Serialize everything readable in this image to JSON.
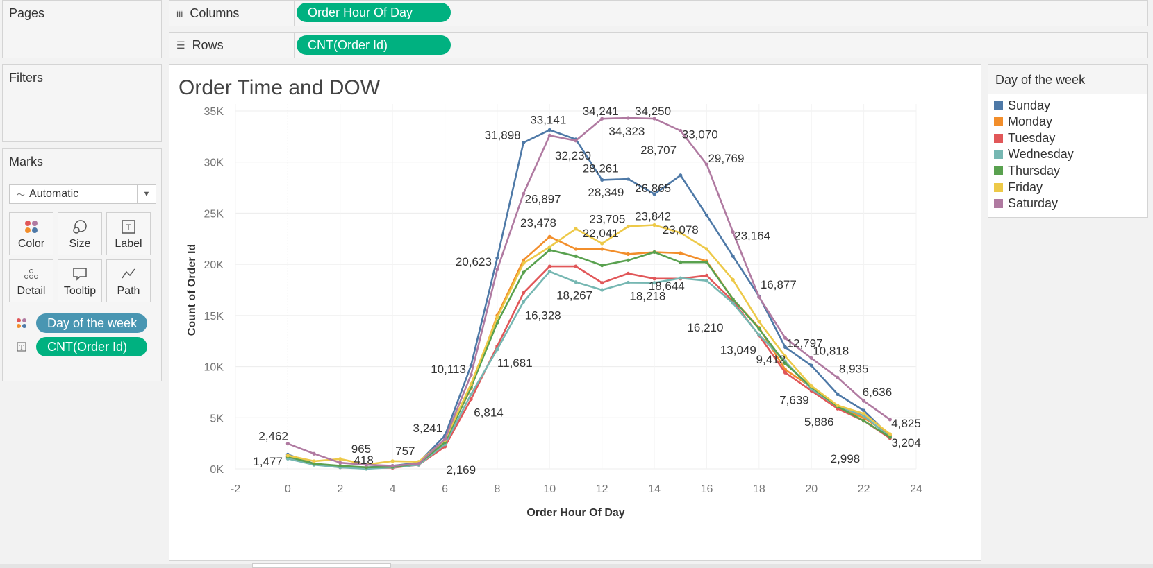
{
  "pages_panel": {
    "title": "Pages"
  },
  "filters_panel": {
    "title": "Filters"
  },
  "columns_shelf": {
    "label": "Columns",
    "pill": "Order Hour Of Day"
  },
  "rows_shelf": {
    "label": "Rows",
    "pill": "CNT(Order Id)"
  },
  "marks_panel": {
    "title": "Marks",
    "mark_type": "Automatic",
    "buttons": [
      {
        "label": "Color"
      },
      {
        "label": "Size"
      },
      {
        "label": "Label"
      },
      {
        "label": "Detail"
      },
      {
        "label": "Tooltip"
      },
      {
        "label": "Path"
      }
    ],
    "fields": [
      {
        "label": "Day of the week",
        "encoding": "color"
      },
      {
        "label": "CNT(Order Id)",
        "encoding": "label"
      }
    ]
  },
  "legend": {
    "title": "Day of the week"
  },
  "chart_data": {
    "type": "line",
    "title": "Order Time and DOW",
    "xlabel": "Order Hour Of Day",
    "ylabel": "Count of Order Id",
    "xlim": [
      -2,
      24
    ],
    "ylim": [
      0,
      35000
    ],
    "x_ticks": [
      -2,
      0,
      2,
      4,
      6,
      8,
      10,
      12,
      14,
      16,
      18,
      20,
      22,
      24
    ],
    "y_ticks": [
      {
        "value": 0,
        "label": "0K"
      },
      {
        "value": 5000,
        "label": "5K"
      },
      {
        "value": 10000,
        "label": "10K"
      },
      {
        "value": 15000,
        "label": "15K"
      },
      {
        "value": 20000,
        "label": "20K"
      },
      {
        "value": 25000,
        "label": "25K"
      },
      {
        "value": 30000,
        "label": "30K"
      },
      {
        "value": 35000,
        "label": "35K"
      }
    ],
    "legend_position": "right",
    "grid": true,
    "x": [
      0,
      1,
      2,
      3,
      4,
      5,
      6,
      7,
      8,
      9,
      10,
      11,
      12,
      13,
      14,
      15,
      16,
      17,
      18,
      19,
      20,
      21,
      22,
      23
    ],
    "series": [
      {
        "name": "Sunday",
        "color": "#4e79a7",
        "values": [
          1400,
          500,
          200,
          150,
          300,
          600,
          3241,
          10113,
          20623,
          31898,
          33141,
          32230,
          28261,
          28349,
          26865,
          28707,
          24800,
          20800,
          16877,
          11900,
          10100,
          7300,
          5700,
          3204
        ]
      },
      {
        "name": "Monday",
        "color": "#f28e2b",
        "values": [
          1200,
          500,
          250,
          150,
          150,
          500,
          2700,
          7900,
          15000,
          20400,
          22700,
          21500,
          21500,
          21000,
          21200,
          21100,
          20300,
          16600,
          13800,
          9700,
          8000,
          6000,
          5000,
          3300
        ]
      },
      {
        "name": "Tuesday",
        "color": "#e15759",
        "values": [
          1100,
          450,
          150,
          80,
          100,
          400,
          2169,
          6814,
          12000,
          17200,
          19800,
          19800,
          18200,
          19100,
          18600,
          18600,
          18900,
          16400,
          13049,
          9412,
          7639,
          5886,
          4700,
          2998
        ]
      },
      {
        "name": "Wednesday",
        "color": "#76b7b2",
        "values": [
          1000,
          400,
          150,
          0,
          150,
          400,
          2400,
          7300,
          11681,
          16328,
          19300,
          18267,
          17500,
          18218,
          18200,
          18644,
          18400,
          16210,
          13100,
          10500,
          7800,
          6100,
          5200,
          3100
        ]
      },
      {
        "name": "Thursday",
        "color": "#59a14f",
        "values": [
          1200,
          500,
          300,
          150,
          200,
          500,
          2600,
          8000,
          14300,
          19200,
          21400,
          20800,
          19900,
          20400,
          21200,
          20200,
          20200,
          16600,
          13700,
          10300,
          8000,
          6100,
          4700,
          3100
        ]
      },
      {
        "name": "Friday",
        "color": "#edc948",
        "values": [
          1300,
          750,
          965,
          418,
          757,
          700,
          2800,
          8300,
          14800,
          20100,
          21700,
          23478,
          22041,
          23705,
          23842,
          23078,
          21500,
          18500,
          14400,
          11000,
          8100,
          6200,
          5400,
          3400
        ]
      },
      {
        "name": "Saturday",
        "color": "#b07aa1",
        "values": [
          2462,
          1477,
          600,
          400,
          300,
          500,
          2900,
          9200,
          19500,
          26897,
          32600,
          32100,
          34241,
          34323,
          34250,
          33070,
          29769,
          23164,
          16800,
          12797,
          10818,
          8935,
          6636,
          4825
        ]
      }
    ],
    "annotations": [
      {
        "x": 0,
        "y": 2462,
        "text": "2,462"
      },
      {
        "x": 0,
        "y": 1477,
        "text": "1,477"
      },
      {
        "x": 2,
        "y": 965,
        "text": "965"
      },
      {
        "x": 3,
        "y": 418,
        "text": "418"
      },
      {
        "x": 4,
        "y": 757,
        "text": "757"
      },
      {
        "x": 6,
        "y": 3241,
        "text": "3,241"
      },
      {
        "x": 6,
        "y": 2169,
        "text": "2,169"
      },
      {
        "x": 7,
        "y": 10113,
        "text": "10,113"
      },
      {
        "x": 7,
        "y": 6814,
        "text": "6,814"
      },
      {
        "x": 8,
        "y": 20623,
        "text": "20,623"
      },
      {
        "x": 8,
        "y": 11681,
        "text": "11,681"
      },
      {
        "x": 9,
        "y": 31898,
        "text": "31,898"
      },
      {
        "x": 9,
        "y": 26897,
        "text": "26,897"
      },
      {
        "x": 9,
        "y": 16328,
        "text": "16,328"
      },
      {
        "x": 10,
        "y": 33141,
        "text": "33,141"
      },
      {
        "x": 11,
        "y": 32230,
        "text": "32,230"
      },
      {
        "x": 11,
        "y": 23478,
        "text": "23,478"
      },
      {
        "x": 11,
        "y": 18267,
        "text": "18,267"
      },
      {
        "x": 12,
        "y": 34241,
        "text": "34,241"
      },
      {
        "x": 12,
        "y": 28261,
        "text": "28,261"
      },
      {
        "x": 12,
        "y": 22041,
        "text": "22,041"
      },
      {
        "x": 13,
        "y": 34323,
        "text": "34,323"
      },
      {
        "x": 13,
        "y": 28349,
        "text": "28,349"
      },
      {
        "x": 13,
        "y": 23705,
        "text": "23,705"
      },
      {
        "x": 13,
        "y": 18218,
        "text": "18,218"
      },
      {
        "x": 14,
        "y": 34250,
        "text": "34,250"
      },
      {
        "x": 14,
        "y": 28707,
        "text": "28,707"
      },
      {
        "x": 14,
        "y": 26865,
        "text": "26,865"
      },
      {
        "x": 14,
        "y": 23842,
        "text": "23,842"
      },
      {
        "x": 15,
        "y": 33070,
        "text": "33,070"
      },
      {
        "x": 15,
        "y": 23078,
        "text": "23,078"
      },
      {
        "x": 15,
        "y": 18644,
        "text": "18,644"
      },
      {
        "x": 16,
        "y": 29769,
        "text": "29,769"
      },
      {
        "x": 16,
        "y": 16210,
        "text": "16,210"
      },
      {
        "x": 17,
        "y": 23164,
        "text": "23,164"
      },
      {
        "x": 18,
        "y": 16877,
        "text": "16,877"
      },
      {
        "x": 18,
        "y": 13049,
        "text": "13,049"
      },
      {
        "x": 19,
        "y": 12797,
        "text": "12,797"
      },
      {
        "x": 19,
        "y": 9412,
        "text": "9,412"
      },
      {
        "x": 20,
        "y": 10818,
        "text": "10,818"
      },
      {
        "x": 20,
        "y": 7639,
        "text": "7,639"
      },
      {
        "x": 21,
        "y": 8935,
        "text": "8,935"
      },
      {
        "x": 21,
        "y": 5886,
        "text": "5,886"
      },
      {
        "x": 22,
        "y": 6636,
        "text": "6,636"
      },
      {
        "x": 23,
        "y": 4825,
        "text": "4,825"
      },
      {
        "x": 23,
        "y": 3204,
        "text": "3,204"
      },
      {
        "x": 22,
        "y": 2998,
        "text": "2,998"
      }
    ]
  }
}
